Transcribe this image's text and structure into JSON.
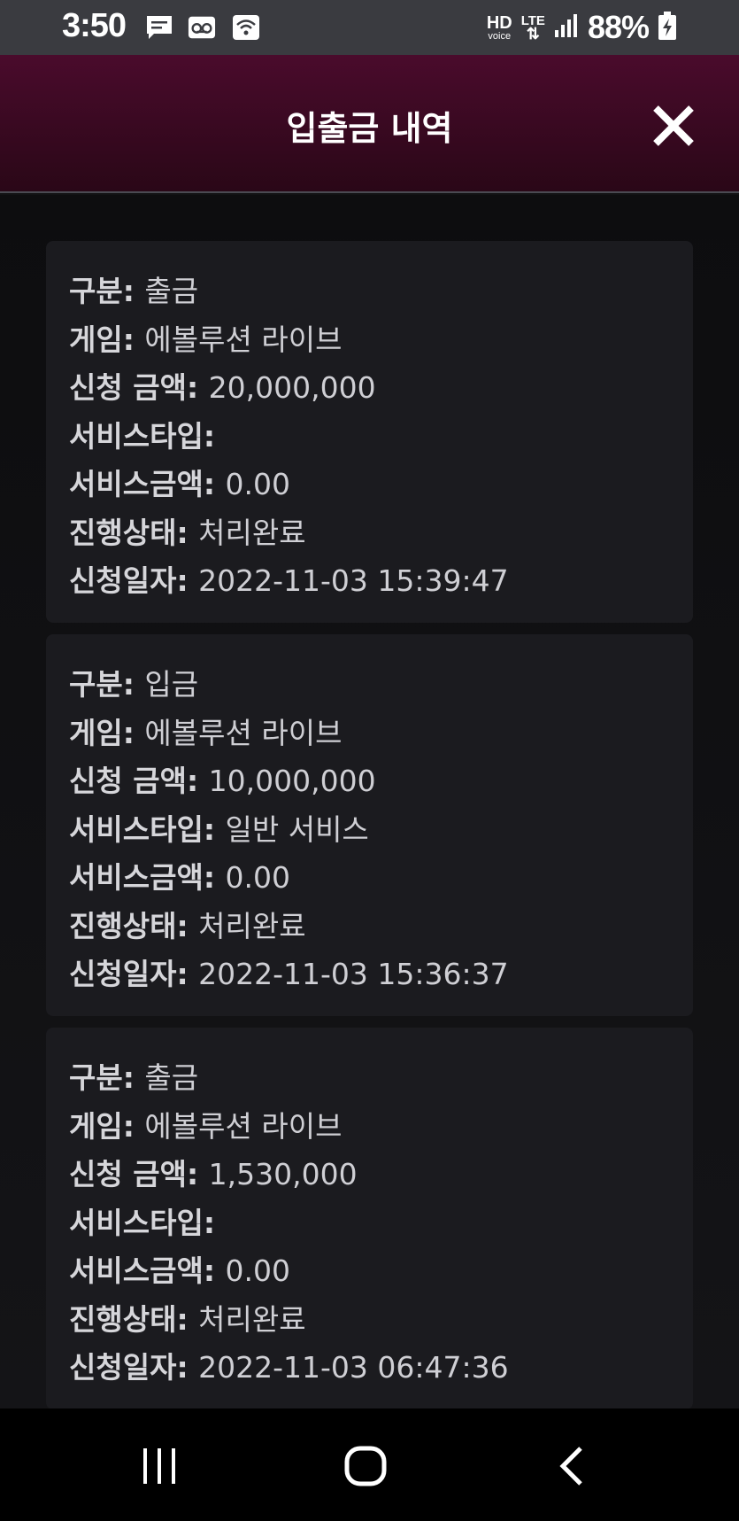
{
  "status_bar": {
    "time": "3:50",
    "hd": "HD",
    "voice": "voice",
    "lte": "LTE",
    "battery": "88%"
  },
  "header": {
    "title": "입출금 내역"
  },
  "labels": {
    "type": "구분",
    "game": "게임",
    "amount": "신청 금액",
    "service_type": "서비스타입",
    "service_amount": "서비스금액",
    "status": "진행상태",
    "date": "신청일자"
  },
  "records": [
    {
      "type": "출금",
      "game": "에볼루션 라이브",
      "amount": "20,000,000",
      "service_type": "",
      "service_amount": "0.00",
      "status": "처리완료",
      "date": "2022-11-03 15:39:47"
    },
    {
      "type": "입금",
      "game": "에볼루션 라이브",
      "amount": "10,000,000",
      "service_type": "일반 서비스",
      "service_amount": "0.00",
      "status": "처리완료",
      "date": "2022-11-03 15:36:37"
    },
    {
      "type": "출금",
      "game": "에볼루션 라이브",
      "amount": "1,530,000",
      "service_type": "",
      "service_amount": "0.00",
      "status": "처리완료",
      "date": "2022-11-03 06:47:36"
    }
  ],
  "colors": {
    "header_top": "#4a0b2c",
    "header_bottom": "#2a0717",
    "card_bg": "#1b1b1f",
    "text": "#cfcfd4"
  },
  "icons": {
    "status": [
      "message-icon",
      "voicemail-icon",
      "wifi-calling-icon",
      "signal-icon",
      "battery-charging-icon"
    ],
    "close": "close-icon",
    "nav": [
      "recent-apps-icon",
      "home-icon",
      "back-icon"
    ]
  }
}
